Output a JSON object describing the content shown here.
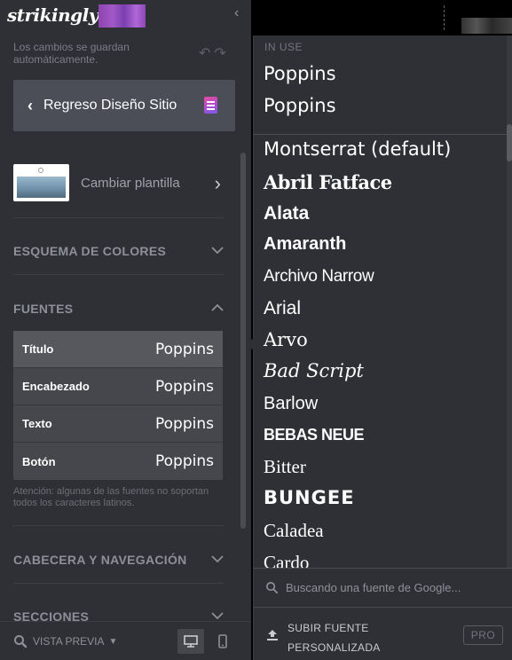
{
  "sidebar": {
    "logo_text": "strikingly",
    "autosave_text": "Los cambios se guardan automáticamente.",
    "undo_icon": "undo-icon",
    "redo_icon": "redo-icon",
    "back_button_label": "Regreso Diseño Sitio",
    "template_label": "Cambiar plantilla",
    "sections": {
      "colors": "ESQUEMA DE COLORES",
      "fonts": "FUENTES",
      "header_nav": "CABECERA Y NAVEGACIÓN",
      "sections": "SECCIONES"
    },
    "font_settings": [
      {
        "key": "Título",
        "value": "Poppins"
      },
      {
        "key": "Encabezado",
        "value": "Poppins"
      },
      {
        "key": "Texto",
        "value": "Poppins"
      },
      {
        "key": "Botón",
        "value": "Poppins"
      }
    ],
    "font_warning": "Atención: algunas de las fuentes no soportan todos los caracteres latinos.",
    "preview_label": "VISTA PREVIA"
  },
  "dropdown": {
    "in_use_label": "IN USE",
    "in_use": [
      "Poppins",
      "Poppins"
    ],
    "fonts": [
      "Montserrat (default)",
      "Abril Fatface",
      "Alata",
      "Amaranth",
      "Archivo Narrow",
      "Arial",
      "Arvo",
      "Bad Script",
      "Barlow",
      "BEBAS NEUE",
      "Bitter",
      "BUNGEE",
      "Caladea",
      "Cardo"
    ],
    "search_placeholder": "Buscando una fuente de Google...",
    "upload_label": "SUBIR FUENTE PERSONALIZADA",
    "pro_badge": "PRO"
  },
  "colors": {
    "sidebar_bg": "#2f3035",
    "active_row": "#56585e",
    "accent_gradient": "#a259c9"
  }
}
